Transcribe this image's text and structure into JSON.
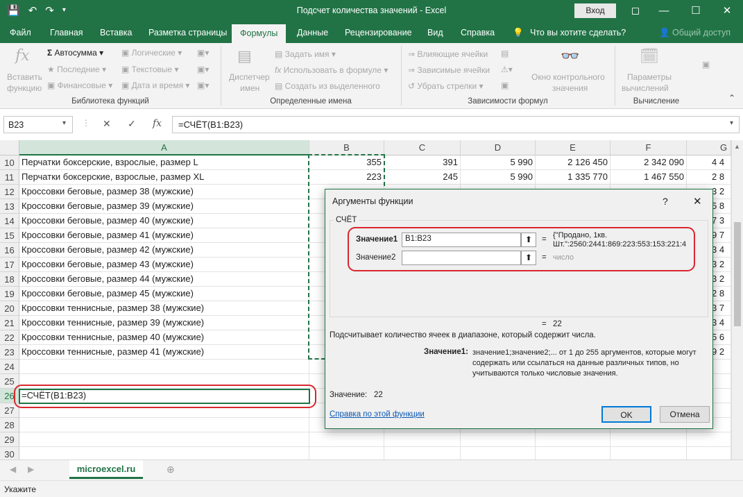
{
  "window": {
    "title": "Подсчет количества значений  -  Excel",
    "login_label": "Вход"
  },
  "tabs": [
    "Файл",
    "Главная",
    "Вставка",
    "Разметка страницы",
    "Формулы",
    "Данные",
    "Рецензирование",
    "Вид",
    "Справка",
    "Что вы хотите сделать?",
    "Общий доступ"
  ],
  "ribbon": {
    "insert_function": [
      "Вставить",
      "функцию"
    ],
    "autosum": "Автосумма",
    "recent": "Последние",
    "financial": "Финансовые",
    "logical": "Логические",
    "text": "Текстовые",
    "datetime": "Дата и время",
    "group_library": "Библиотека функций",
    "name_manager": [
      "Диспетчер",
      "имен"
    ],
    "define_name": "Задать имя",
    "use_in_formula": "Использовать в формуле",
    "create_from_selection": "Создать из выделенного",
    "group_names": "Определенные имена",
    "trace_precedents": "Влияющие ячейки",
    "trace_dependents": "Зависимые ячейки",
    "remove_arrows": "Убрать стрелки",
    "watch_window": [
      "Окно контрольного",
      "значения"
    ],
    "group_audit": "Зависимости формул",
    "calc_options": [
      "Параметры",
      "вычислений"
    ],
    "group_calc": "Вычисление",
    "fx": "fx"
  },
  "formula_bar": {
    "name_box": "B23",
    "formula": "=СЧЁТ(B1:B23)"
  },
  "grid": {
    "columns": [
      "A",
      "B",
      "C",
      "D",
      "E",
      "F",
      "G"
    ],
    "rows": [
      {
        "n": "10",
        "a": "Перчатки боксерские, взрослые, размер L",
        "b": "355",
        "c": "391",
        "d": "5 990",
        "e": "2 126 450",
        "f": "2 342 090",
        "g": "4 4"
      },
      {
        "n": "11",
        "a": "Перчатки боксерские, взрослые, размер XL",
        "b": "223",
        "c": "245",
        "d": "5 990",
        "e": "1 335 770",
        "f": "1 467 550",
        "g": "2 8"
      },
      {
        "n": "12",
        "a": "Кроссовки беговые, размер 38 (мужские)",
        "b": "",
        "c": "",
        "d": "",
        "e": "",
        "f": "",
        "g": "3 2"
      },
      {
        "n": "13",
        "a": "Кроссовки беговые, размер 39 (мужские)",
        "b": "",
        "c": "",
        "d": "",
        "e": "",
        "f": "",
        "g": "5 8"
      },
      {
        "n": "14",
        "a": "Кроссовки беговые, размер 40 (мужские)",
        "b": "",
        "c": "",
        "d": "",
        "e": "",
        "f": "",
        "g": "7 3"
      },
      {
        "n": "15",
        "a": "Кроссовки беговые, размер 41 (мужские)",
        "b": "",
        "c": "",
        "d": "",
        "e": "",
        "f": "",
        "g": "9 7"
      },
      {
        "n": "16",
        "a": "Кроссовки беговые, размер 42 (мужские)",
        "b": "",
        "c": "",
        "d": "",
        "e": "",
        "f": "",
        "g": "3 4"
      },
      {
        "n": "17",
        "a": "Кроссовки беговые, размер 43 (мужские)",
        "b": "",
        "c": "",
        "d": "",
        "e": "",
        "f": "",
        "g": "3 2"
      },
      {
        "n": "18",
        "a": "Кроссовки беговые, размер 44 (мужские)",
        "b": "",
        "c": "",
        "d": "",
        "e": "",
        "f": "",
        "g": "3 2"
      },
      {
        "n": "19",
        "a": "Кроссовки беговые, размер 45 (мужские)",
        "b": "",
        "c": "",
        "d": "",
        "e": "",
        "f": "",
        "g": "2 8"
      },
      {
        "n": "20",
        "a": "Кроссовки теннисные, размер 38 (мужские)",
        "b": "",
        "c": "",
        "d": "",
        "e": "",
        "f": "",
        "g": "3 7"
      },
      {
        "n": "21",
        "a": "Кроссовки теннисные, размер 39 (мужские)",
        "b": "",
        "c": "",
        "d": "",
        "e": "",
        "f": "",
        "g": "3 4"
      },
      {
        "n": "22",
        "a": "Кроссовки теннисные, размер 40 (мужские)",
        "b": "",
        "c": "",
        "d": "",
        "e": "",
        "f": "",
        "g": "5 6"
      },
      {
        "n": "23",
        "a": "Кроссовки теннисные, размер 41 (мужские)",
        "b": "",
        "c": "",
        "d": "",
        "e": "",
        "f": "",
        "g": "9 2"
      },
      {
        "n": "24",
        "a": "",
        "b": "",
        "c": "",
        "d": "",
        "e": "",
        "f": "",
        "g": ""
      },
      {
        "n": "25",
        "a": "",
        "b": "",
        "c": "",
        "d": "",
        "e": "",
        "f": "",
        "g": ""
      },
      {
        "n": "26",
        "a": "=СЧЁТ(B1:B23)",
        "b": "",
        "c": "",
        "d": "",
        "e": "",
        "f": "",
        "g": ""
      },
      {
        "n": "27",
        "a": "",
        "b": "",
        "c": "",
        "d": "",
        "e": "",
        "f": "",
        "g": ""
      },
      {
        "n": "28",
        "a": "",
        "b": "",
        "c": "",
        "d": "",
        "e": "",
        "f": "",
        "g": ""
      },
      {
        "n": "29",
        "a": "",
        "b": "",
        "c": "",
        "d": "",
        "e": "",
        "f": "",
        "g": ""
      },
      {
        "n": "30",
        "a": "",
        "b": "",
        "c": "",
        "d": "",
        "e": "",
        "f": "",
        "g": ""
      }
    ]
  },
  "sheet_tab": "microexcel.ru",
  "status": "Укажите",
  "dialog": {
    "title": "Аргументы функции",
    "help_glyph": "?",
    "function_name": "СЧЁТ",
    "arg1_label": "Значение1",
    "arg1_value": "B1:B23",
    "arg1_result_line1": "{\"Продано, 1кв.",
    "arg1_result_line2": "Шт.\":2560:2441:869:223:553:153:221:4",
    "arg2_label": "Значение2",
    "arg2_value": "",
    "arg2_result": "число",
    "eq": "=",
    "formula_result": "22",
    "description": "Подсчитывает количество ячеек в диапазоне, который содержит числа.",
    "arg_help_label": "Значение1:",
    "arg_help_text": [
      "значение1;значение2;... от 1 до 255 аргументов, которые могут",
      "содержать или ссылаться на данные различных типов, но",
      "учитываются только числовые значения."
    ],
    "value_label": "Значение:",
    "value": "22",
    "help_link": "Справка по этой функции",
    "ok": "OK",
    "cancel": "Отмена"
  },
  "colors": {
    "excel_green": "#217346",
    "highlight_red": "#d9262f"
  }
}
